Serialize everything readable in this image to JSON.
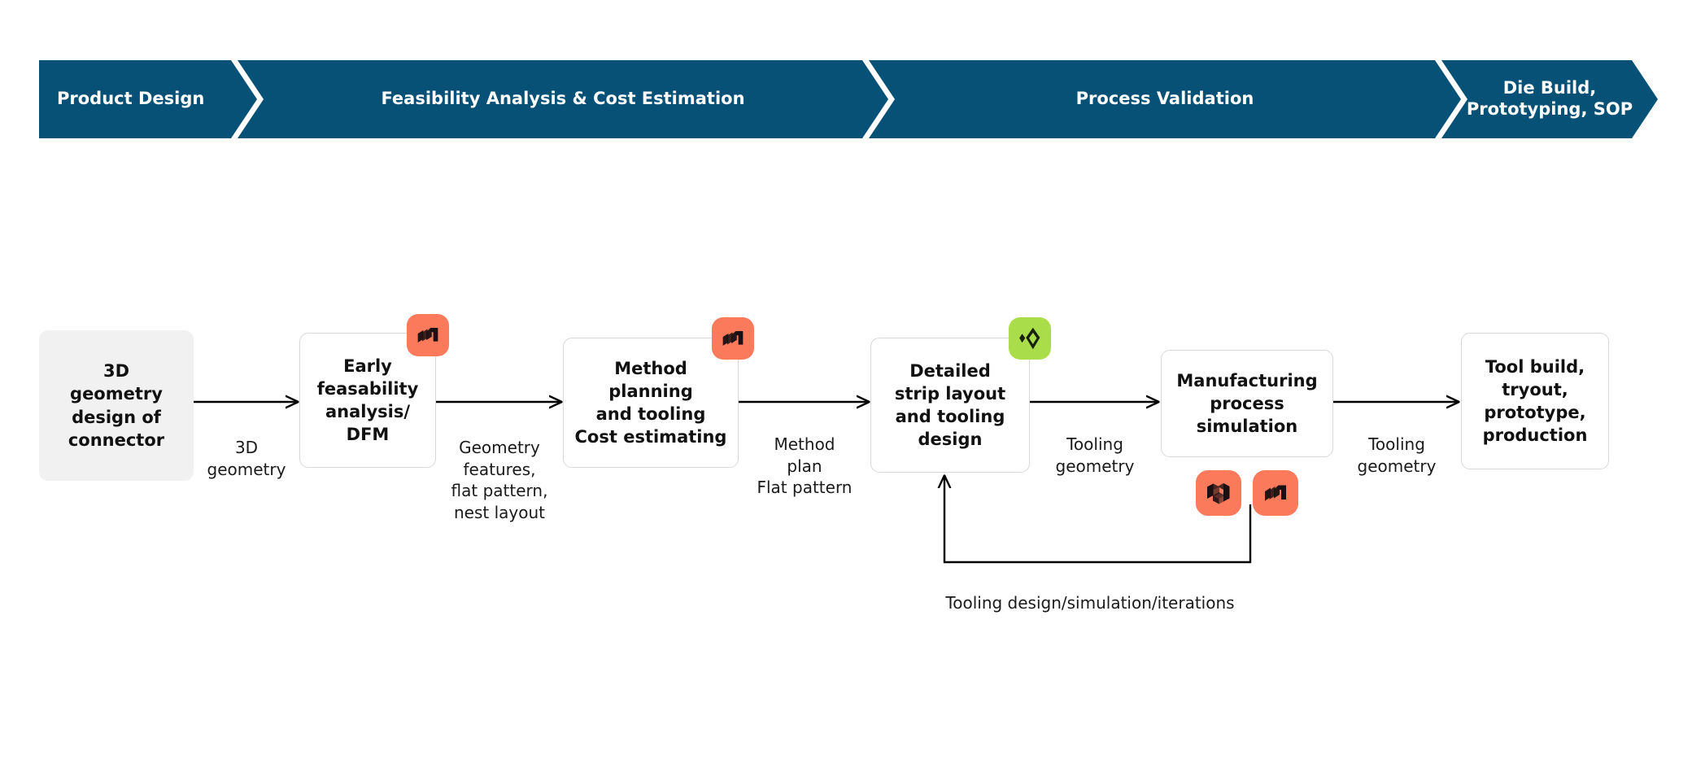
{
  "colors": {
    "banner": "#075076",
    "banner_text": "#ffffff",
    "start_node_fill": "#f1f1f1",
    "node_fill": "#ffffff",
    "node_border": "#d8d8d8",
    "icon_orange": "#fb7a5c",
    "icon_green": "#a9de4a",
    "icon_glyph_dark": "#1a1012",
    "connector": "#000000",
    "text": "#111111"
  },
  "banner": {
    "phases": [
      {
        "label": "Product Design"
      },
      {
        "label": "Feasibility Analysis & Cost Estimation"
      },
      {
        "label": "Process Validation"
      },
      {
        "label": "Die Build,\nPrototyping, SOP"
      }
    ]
  },
  "flow": {
    "nodes": [
      {
        "id": "n1",
        "label": "3D\ngeometry\ndesign of\nconnector",
        "style": "start"
      },
      {
        "id": "n2",
        "label": "Early\nfeasability\nanalysis/\nDFM",
        "style": "card"
      },
      {
        "id": "n3",
        "label": "Method\nplanning\nand tooling\nCost estimating",
        "style": "card"
      },
      {
        "id": "n4",
        "label": "Detailed\nstrip layout\nand tooling\ndesign",
        "style": "card"
      },
      {
        "id": "n5",
        "label": "Manufacturing\nprocess\nsimulation",
        "style": "card"
      },
      {
        "id": "n6",
        "label": "Tool build,\ntryout,\nprototype,\nproduction",
        "style": "card"
      }
    ],
    "edges": [
      {
        "id": "e1",
        "from": "n1",
        "to": "n2",
        "label": "3D\ngeometry"
      },
      {
        "id": "e2",
        "from": "n2",
        "to": "n3",
        "label": "Geometry\nfeatures,\nflat pattern,\nnest layout"
      },
      {
        "id": "e3",
        "from": "n3",
        "to": "n4",
        "label": "Method\nplan\nFlat pattern"
      },
      {
        "id": "e4",
        "from": "n4",
        "to": "n5",
        "label": "Tooling\ngeometry"
      },
      {
        "id": "e5",
        "from": "n5",
        "to": "n6",
        "label": "Tooling\ngeometry"
      }
    ],
    "feedback_loop": {
      "label": "Tooling design/simulation/iterations",
      "from": "n5",
      "to": "n4"
    }
  },
  "icons": [
    {
      "id": "icon-n2",
      "name": "stacked-layers-logo",
      "color": "#fb7a5c",
      "attached_to": "n2"
    },
    {
      "id": "icon-n3",
      "name": "stacked-layers-logo",
      "color": "#fb7a5c",
      "attached_to": "n3"
    },
    {
      "id": "icon-n4",
      "name": "green-gem-logo",
      "color": "#a9de4a",
      "attached_to": "n4"
    },
    {
      "id": "icon-n5-a",
      "name": "cube-block-logo",
      "color": "#fb7a5c",
      "attached_to": "n5"
    },
    {
      "id": "icon-n5-b",
      "name": "stacked-layers-logo",
      "color": "#fb7a5c",
      "attached_to": "n5"
    }
  ]
}
